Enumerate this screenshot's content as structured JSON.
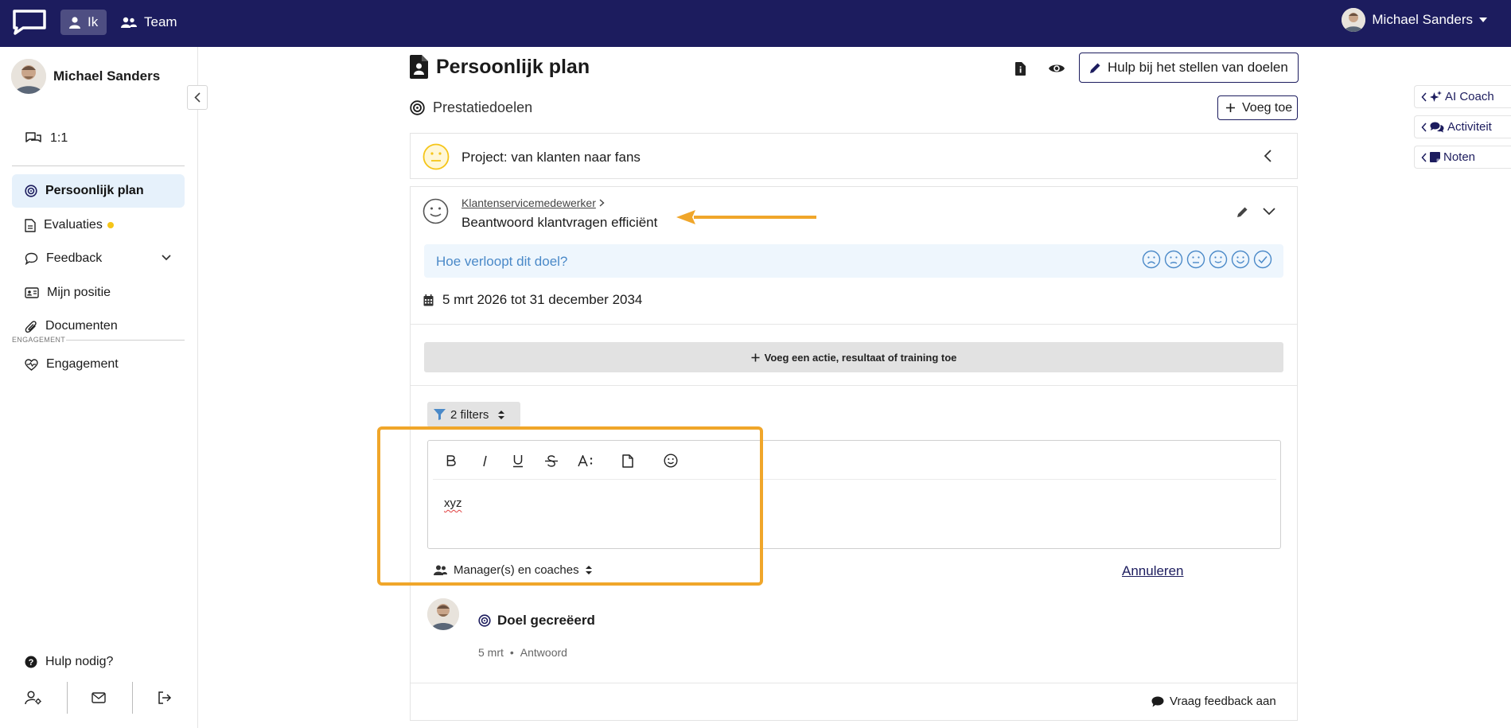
{
  "topbar": {
    "nav_me": "Ik",
    "nav_team": "Team",
    "user_name": "Michael Sanders"
  },
  "sidebar": {
    "user_name": "Michael Sanders",
    "one_on_one": "1:1",
    "items": [
      {
        "label": "Persoonlijk plan",
        "icon": "target-icon",
        "active": true
      },
      {
        "label": "Evaluaties",
        "icon": "document-icon",
        "badge": "dot"
      },
      {
        "label": "Feedback",
        "icon": "chat-icon",
        "has_chevron": true
      },
      {
        "label": "Mijn positie",
        "icon": "id-card-icon"
      },
      {
        "label": "Documenten",
        "icon": "paperclip-icon"
      }
    ],
    "section_engagement": "ENGAGEMENT",
    "engagement_item": "Engagement",
    "help": "Hulp nodig?"
  },
  "main": {
    "title": "Persoonlijk plan",
    "help_button": "Hulp bij het stellen van doelen",
    "section_title": "Prestatiedoelen",
    "add_button": "Voeg toe",
    "project": {
      "title": "Project: van klanten naar fans"
    },
    "goal": {
      "breadcrumb": "Klantenservicemedewerker",
      "title": "Beantwoord klantvragen efficiënt",
      "mood_question": "Hoe verloopt dit doel?",
      "dates": "5 mrt 2026 tot 31 december 2034",
      "add_action": "Voeg een actie, resultaat of training toe"
    },
    "filters": {
      "label": "2 filters"
    },
    "editor": {
      "text": "xyz"
    },
    "audience": "Manager(s) en coaches",
    "cancel": "Annuleren",
    "activity": {
      "title": "Doel gecreëerd",
      "date": "5 mrt",
      "reply": "Antwoord"
    },
    "ask_feedback": "Vraag feedback aan"
  },
  "right_panel": {
    "tabs": [
      {
        "label": "AI Coach",
        "icon": "sparkle-icon"
      },
      {
        "label": "Activiteit",
        "icon": "comments-icon"
      },
      {
        "label": "Noten",
        "icon": "note-icon"
      }
    ]
  },
  "colors": {
    "topbar": "#1c1c5e",
    "accent": "#1c1c5e",
    "active_item_bg": "#e6f1fb",
    "highlight": "#f0a62a",
    "mood_text": "#4a89c8",
    "neutral_face": "#f5c518"
  }
}
